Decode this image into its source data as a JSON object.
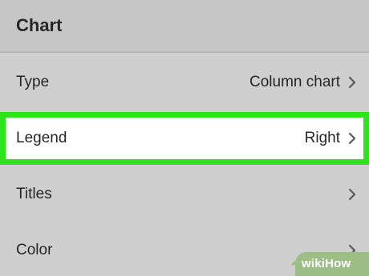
{
  "header": {
    "title": "Chart"
  },
  "rows": [
    {
      "label": "Type",
      "value": "Column chart"
    },
    {
      "label": "Legend",
      "value": "Right"
    },
    {
      "label": "Titles",
      "value": ""
    },
    {
      "label": "Color",
      "value": ""
    }
  ],
  "highlight_color": "#2ee21c",
  "icons": {
    "row_chevron": "chevron-right-icon"
  },
  "watermark": {
    "text": "wikiHow"
  }
}
